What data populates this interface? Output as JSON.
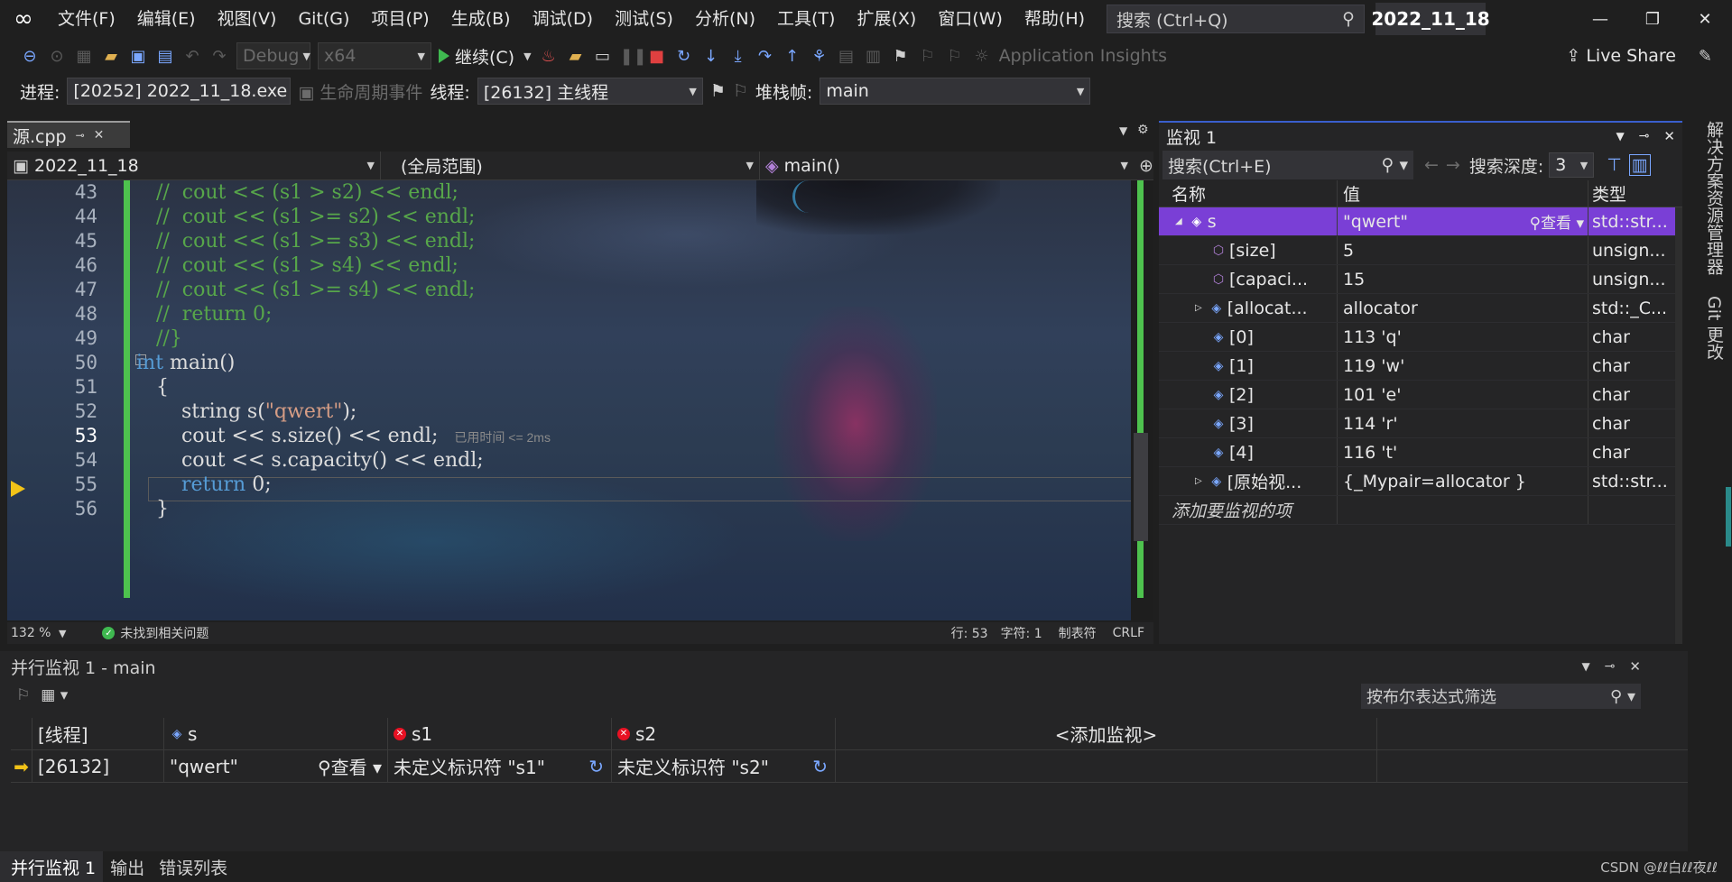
{
  "titlebar": {
    "menus": [
      "文件(F)",
      "编辑(E)",
      "视图(V)",
      "Git(G)",
      "项目(P)",
      "生成(B)",
      "调试(D)",
      "测试(S)",
      "分析(N)",
      "工具(T)",
      "扩展(X)",
      "窗口(W)",
      "帮助(H)"
    ],
    "search_placeholder": "搜索 (Ctrl+Q)",
    "solution_name": "2022_11_18"
  },
  "toolbar": {
    "config": "Debug",
    "platform": "x64",
    "continue_label": "继续(C)",
    "app_insights": "Application Insights",
    "live_share": "Live Share"
  },
  "debugbar": {
    "process_label": "进程:",
    "process_value": "[20252] 2022_11_18.exe",
    "lifecycle_label": "生命周期事件",
    "thread_label": "线程:",
    "thread_value": "[26132] 主线程",
    "stackframe_label": "堆栈帧:",
    "stackframe_value": "main"
  },
  "editor": {
    "tab_name": "源.cpp",
    "nav_project": "2022_11_18",
    "nav_scope": "(全局范围)",
    "nav_function": "main()",
    "line_numbers": [
      "43",
      "44",
      "45",
      "46",
      "47",
      "48",
      "49",
      "50",
      "51",
      "52",
      "53",
      "54",
      "55",
      "56"
    ],
    "lines": {
      "l43": "//  cout << (s1 > s2) << endl;",
      "l44": "//  cout << (s1 >= s2) << endl;",
      "l45": "//  cout << (s1 >= s3) << endl;",
      "l46": "//  cout << (s1 > s4) << endl;",
      "l47": "//  cout << (s1 >= s4) << endl;",
      "l48": "//  return 0;",
      "l49": "//}",
      "l50_kw": "int",
      "l50_rest": " main()",
      "l51": "{",
      "l52_pre": "    string s(",
      "l52_str": "\"qwert\"",
      "l52_post": ");",
      "l53": "    cout << s.size() << endl;",
      "l54": "    cout << s.capacity() << endl;",
      "l55_kw": "return",
      "l55_rest": " 0;",
      "l56": "}"
    },
    "perf_tip": "已用时间 <= 2ms",
    "status": {
      "zoom": "132 %",
      "issues": "未找到相关问题",
      "line": "行: 53",
      "char": "字符: 1",
      "tabs": "制表符",
      "eol": "CRLF"
    }
  },
  "watch": {
    "title": "监视 1",
    "search_placeholder": "搜索(Ctrl+E)",
    "depth_label": "搜索深度:",
    "depth_value": "3",
    "columns": [
      "名称",
      "值",
      "类型"
    ],
    "view_label": "查看",
    "rows": [
      {
        "name": "s",
        "value": "\"qwert\"",
        "type": "std::str..."
      },
      {
        "name": "[size]",
        "value": "5",
        "type": "unsign..."
      },
      {
        "name": "[capaci...",
        "value": "15",
        "type": "unsign..."
      },
      {
        "name": "[allocat...",
        "value": "allocator",
        "type": "std::_C..."
      },
      {
        "name": "[0]",
        "value": "113 'q'",
        "type": "char"
      },
      {
        "name": "[1]",
        "value": "119 'w'",
        "type": "char"
      },
      {
        "name": "[2]",
        "value": "101 'e'",
        "type": "char"
      },
      {
        "name": "[3]",
        "value": "114 'r'",
        "type": "char"
      },
      {
        "name": "[4]",
        "value": "116 't'",
        "type": "char"
      },
      {
        "name": "[原始视...",
        "value": "{_Mypair=allocator }",
        "type": "std::str..."
      }
    ],
    "add_item": "添加要监视的项"
  },
  "sidetabs": {
    "solution_explorer": "解决方案资源管理器",
    "git_changes": "Git 更改"
  },
  "parallel_watch": {
    "title": "并行监视 1 - main",
    "filter_placeholder": "按布尔表达式筛选",
    "col_thread": "[线程]",
    "col_s": "s",
    "col_s1": "s1",
    "col_s2": "s2",
    "col_add": "<添加监视>",
    "row_thread": "[26132]",
    "row_s": "\"qwert\"",
    "row_view": "查看",
    "row_s1": "未定义标识符 \"s1\"",
    "row_s2": "未定义标识符 \"s2\""
  },
  "bottom_tabs": [
    "并行监视 1",
    "输出",
    "错误列表"
  ],
  "watermark": "CSDN @ℓℓ白ℓℓ夜ℓℓ"
}
